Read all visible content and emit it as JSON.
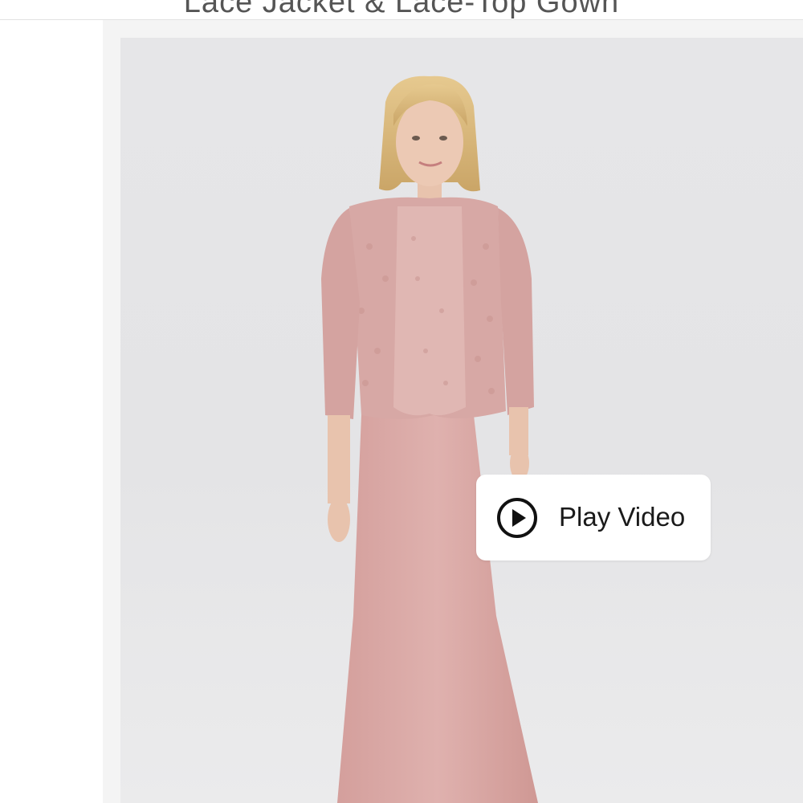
{
  "product": {
    "title": "Lace Jacket & Lace-Top Gown"
  },
  "media": {
    "play_label": "Play Video",
    "play_icon": "play-circle-icon",
    "dress_color": "#d9a7a4",
    "background_color": "#e6e6e8"
  }
}
